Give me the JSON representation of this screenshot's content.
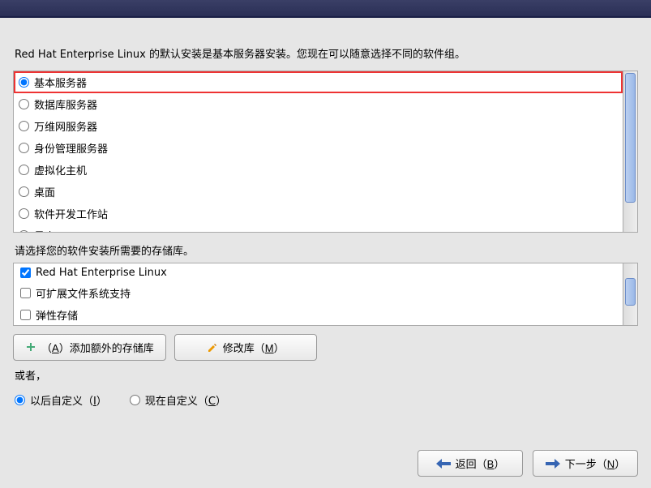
{
  "intro": "Red Hat Enterprise Linux 的默认安装是基本服务器安装。您现在可以随意选择不同的软件组。",
  "software_groups": [
    {
      "label": "基本服务器",
      "selected": true,
      "highlighted": true
    },
    {
      "label": "数据库服务器",
      "selected": false
    },
    {
      "label": "万维网服务器",
      "selected": false
    },
    {
      "label": "身份管理服务器",
      "selected": false
    },
    {
      "label": "虚拟化主机",
      "selected": false
    },
    {
      "label": "桌面",
      "selected": false
    },
    {
      "label": "软件开发工作站",
      "selected": false
    },
    {
      "label": "最小",
      "selected": false
    }
  ],
  "repo_heading": "请选择您的软件安装所需要的存储库。",
  "repos": [
    {
      "label": "Red Hat Enterprise Linux",
      "checked": true
    },
    {
      "label": "可扩展文件系统支持",
      "checked": false
    },
    {
      "label": "弹性存储",
      "checked": false
    }
  ],
  "buttons": {
    "add_repo_prefix": "（",
    "add_repo_accel": "A",
    "add_repo_suffix": "）添加额外的存储库",
    "modify_repo_prefix": "修改库（",
    "modify_repo_accel": "M",
    "modify_repo_suffix": "）"
  },
  "or_text": "或者，",
  "customize": {
    "later_prefix": "以后自定义（",
    "later_accel": "I",
    "later_suffix": "）",
    "now_prefix": "现在自定义（",
    "now_accel": "C",
    "now_suffix": "）"
  },
  "nav": {
    "back_prefix": "返回（",
    "back_accel": "B",
    "back_suffix": "）",
    "next_prefix": "下一步（",
    "next_accel": "N",
    "next_suffix": "）"
  }
}
